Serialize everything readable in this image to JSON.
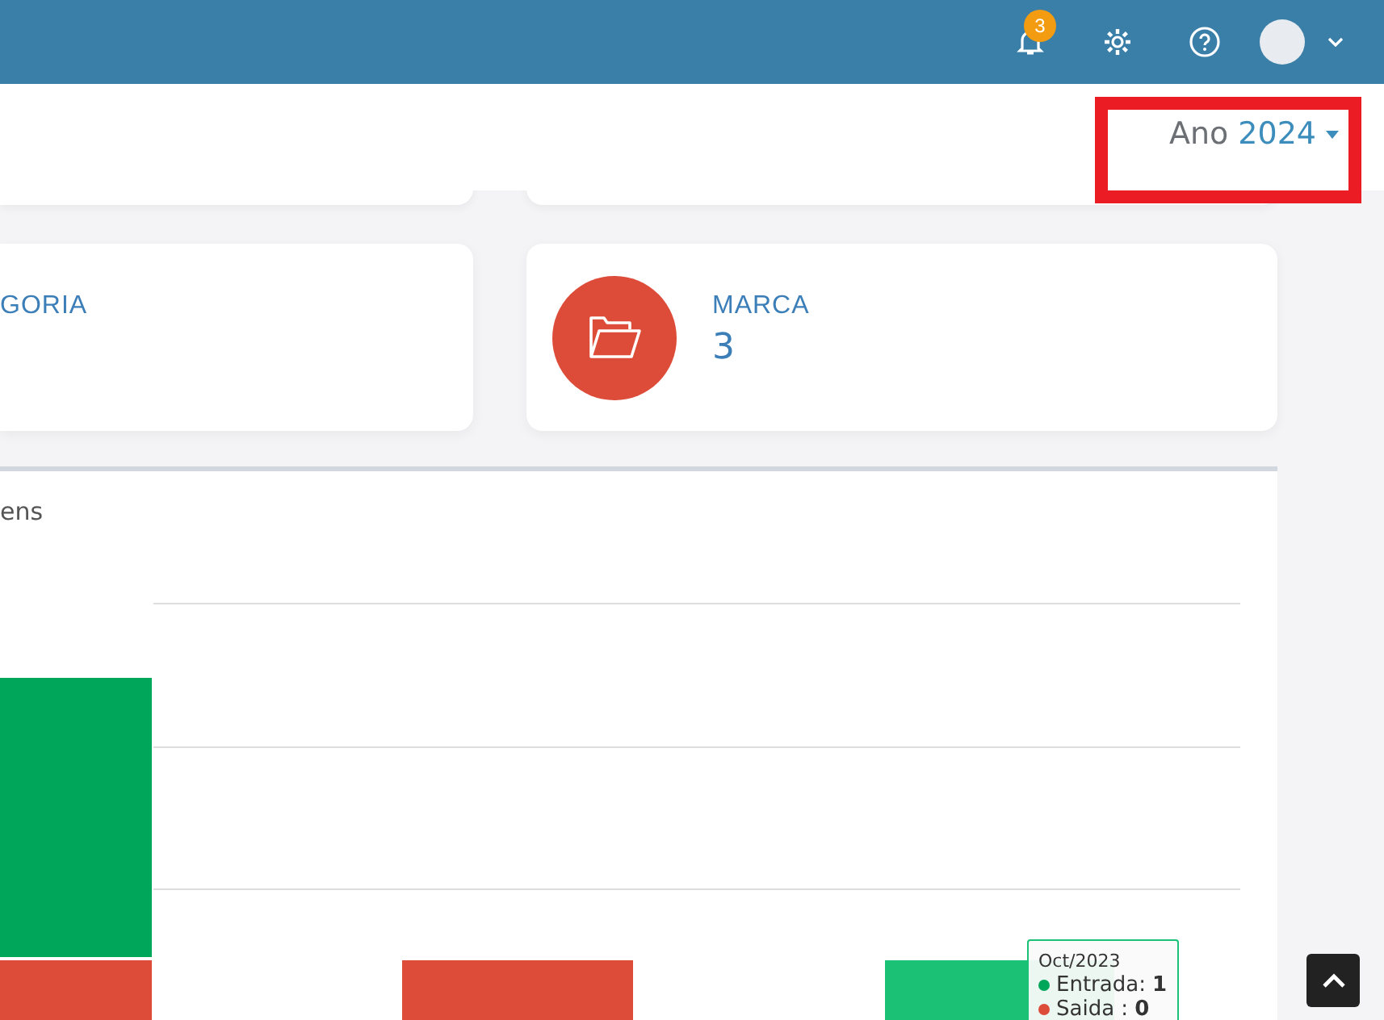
{
  "topbar": {
    "notifications": {
      "count": "3"
    }
  },
  "year_filter": {
    "label": "Ano",
    "value": "2024"
  },
  "cards": [
    {
      "kind": "cut",
      "title": "GORIA"
    },
    {
      "kind": "full",
      "title": "MARCA",
      "value": "3"
    }
  ],
  "chart_panel": {
    "title": "ens",
    "tooltip": {
      "title": "Oct/2023",
      "rows": [
        {
          "label": "Entrada:",
          "value": "1",
          "color": "#00a65a"
        },
        {
          "label": "Saida :",
          "value": "0",
          "color": "#dd4b39"
        }
      ]
    }
  }
}
